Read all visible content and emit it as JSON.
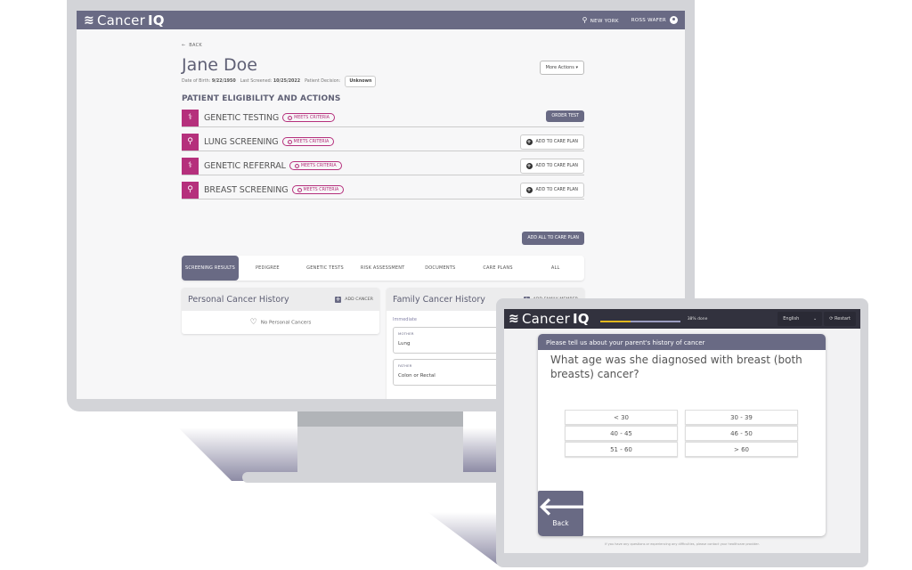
{
  "desktop": {
    "header": {
      "logo_text": "Cancer",
      "logo_bold": "IQ",
      "location_label": "NEW YORK",
      "user_name": "ROSS WAFER"
    },
    "back_label": "BACK",
    "patient": {
      "name": "Jane Doe",
      "dob_label": "Date of Birth:",
      "dob_value": "9/22/1950",
      "last_screened_label": "Last Screened:",
      "last_screened_value": "10/25/2022",
      "decision_label": "Patient Decision:",
      "decision_value": "Unknown"
    },
    "more_actions_label": "More Actions ▾",
    "section_title": "PATIENT ELIGIBILITY AND ACTIONS",
    "eligibility": [
      {
        "label": "GENETIC TESTING",
        "badge": "MEETS CRITERIA",
        "action": "ORDER TEST",
        "icon": "dna-icon"
      },
      {
        "label": "LUNG SCREENING",
        "badge": "MEETS CRITERIA",
        "action": "ADD TO CARE PLAN",
        "icon": "person-search-icon"
      },
      {
        "label": "GENETIC REFERRAL",
        "badge": "MEETS CRITERIA",
        "action": "ADD TO CARE PLAN",
        "icon": "dna-icon"
      },
      {
        "label": "BREAST SCREENING",
        "badge": "MEETS CRITERIA",
        "action": "ADD TO CARE PLAN",
        "icon": "person-search-icon"
      }
    ],
    "add_all_label": "ADD ALL TO CARE PLAN",
    "tabs": [
      {
        "label": "SCREENING RESULTS",
        "active": true
      },
      {
        "label": "PEDIGREE"
      },
      {
        "label": "GENETIC TESTS"
      },
      {
        "label": "RISK ASSESSMENT"
      },
      {
        "label": "DOCUMENTS"
      },
      {
        "label": "CARE PLANS"
      },
      {
        "label": "ALL"
      }
    ],
    "personal_history": {
      "title": "Personal Cancer History",
      "action": "ADD CANCER",
      "empty_text": "No Personal Cancers"
    },
    "family_history": {
      "title": "Family Cancer History",
      "action": "ADD FAMILY MEMBER",
      "group_label": "Immediate",
      "members": [
        {
          "role": "MOTHER",
          "cancer": "Lung"
        },
        {
          "role": "FATHER",
          "cancer": "Colon or Rectal"
        }
      ]
    }
  },
  "tablet": {
    "logo_text": "Cancer",
    "logo_bold": "IQ",
    "progress_percent": 38,
    "progress_text": "38% done",
    "language": "English",
    "restart_label": "Restart",
    "section_heading": "Please tell us about your parent's history of cancer",
    "question": "What age was she diagnosed with breast (both breasts) cancer?",
    "options": [
      "< 30",
      "30 - 39",
      "40 - 45",
      "46 - 50",
      "51 - 60",
      "> 60"
    ],
    "back_label": "Back",
    "footer_note": "If you have any questions or experiencing any difficulties, please contact your healthcare provider."
  },
  "colors": {
    "brand_purple": "#696a84",
    "accent_pink": "#b5307c",
    "tablet_header": "#32323e",
    "progress_yellow": "#e2b81e"
  }
}
